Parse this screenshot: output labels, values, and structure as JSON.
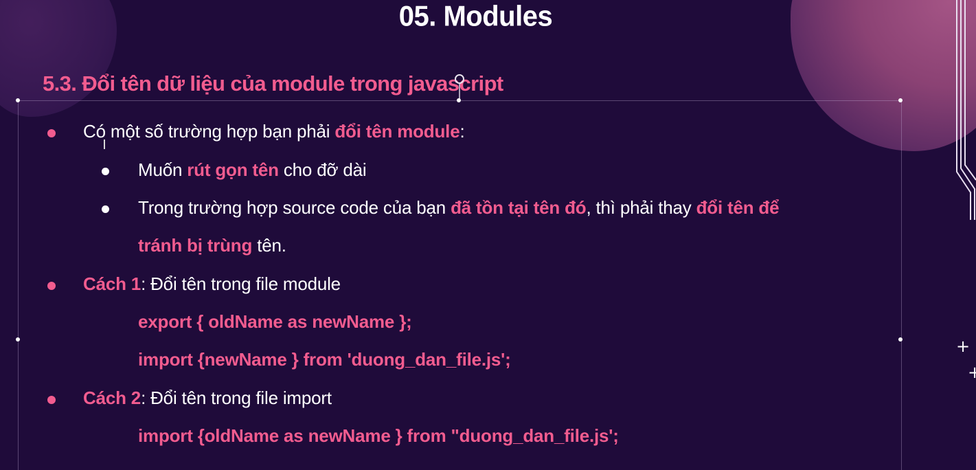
{
  "slide": {
    "title": "05. Modules",
    "subtitle": "5.3. Đổi tên dữ liệu của module trong javascript"
  },
  "bullets": {
    "b1": {
      "prefix": "Có một số trường hợp bạn phải ",
      "highlight": "đổi tên module",
      "suffix": ":"
    },
    "b1_1": {
      "prefix": "Muốn ",
      "highlight": "rút gọn tên",
      "suffix": " cho đỡ dài"
    },
    "b1_2": {
      "prefix": "Trong trường hợp source code của bạn ",
      "highlight1": "đã tồn tại tên đó",
      "middle": ", thì phải thay ",
      "highlight2": "đổi tên để",
      "line2_highlight": "tránh bị trùng",
      "line2_suffix": " tên."
    },
    "b2": {
      "label": "Cách 1",
      "text": ": Đổi tên trong file module",
      "code1": "export { oldName as newName };",
      "code2": "import {newName } from 'duong_dan_file.js';"
    },
    "b3": {
      "label": "Cách 2",
      "text": ": Đổi tên trong file import",
      "code1": "import {oldName as newName } from \"duong_dan_file.js';"
    }
  },
  "decor": {
    "plus_symbol": "+",
    "accent_color": "#f25c8f",
    "background_color": "#1f0b3a"
  }
}
